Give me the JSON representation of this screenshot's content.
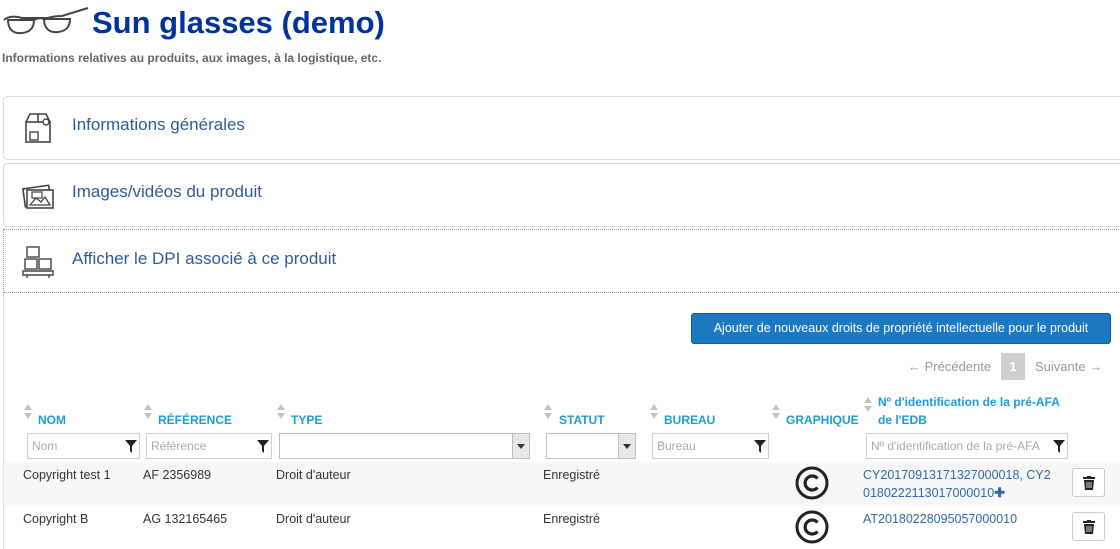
{
  "header": {
    "title": "Sun glasses (demo)",
    "subtitle": "Informations relatives au produits, aux images, à la logistique, etc.",
    "logo_icon": "glasses-icon"
  },
  "panels": [
    {
      "label": "Informations générales",
      "icon": "box-icon"
    },
    {
      "label": "Images/vidéos du produit",
      "icon": "images-icon"
    },
    {
      "label": "Afficher le DPI associé à ce produit",
      "icon": "ip-rights-icon"
    }
  ],
  "toolbar": {
    "add_rights_label": "Ajouter de nouveaux droits de propriété intellectuelle pour le produit"
  },
  "pagination": {
    "prev_label": "← Précédente",
    "current_page": "1",
    "next_label": "Suivante →"
  },
  "table": {
    "columns": {
      "nom": "NOM",
      "reference": "RÉFÉRENCE",
      "type": "TYPE",
      "statut": "STATUT",
      "bureau": "BUREAU",
      "graphique": "GRAPHIQUE",
      "id_line1": "Nº d'identification de la pré-AFA",
      "id_line2": "de l'EDB"
    },
    "filters": {
      "nom_placeholder": "Nom",
      "reference_placeholder": "Référence",
      "type_value": "",
      "statut_value": "",
      "bureau_placeholder": "Bureau",
      "id_placeholder": "Nº d'identification de la pré-AFA"
    },
    "rows": [
      {
        "nom": "Copyright test 1",
        "reference": "AF 2356989",
        "type": "Droit d'auteur",
        "statut": "Enregistré",
        "graphic_icon": "copyright-icon",
        "ids_line1": "CY20170913171327000018, CY2",
        "ids_line2": "0180222113017000010",
        "has_more": true
      },
      {
        "nom": "Copyright B",
        "reference": "AG 132165465",
        "type": "Droit d'auteur",
        "statut": "Enregistré",
        "graphic_icon": "copyright-icon",
        "ids_line1": "AT20180228095057000010",
        "ids_line2": "",
        "has_more": false
      }
    ]
  },
  "colors": {
    "title": "#003399",
    "panel_label": "#2f5b9c",
    "column_header": "#1c9cd8",
    "primary_button": "#1c78c0",
    "link": "#2e6aa8"
  }
}
